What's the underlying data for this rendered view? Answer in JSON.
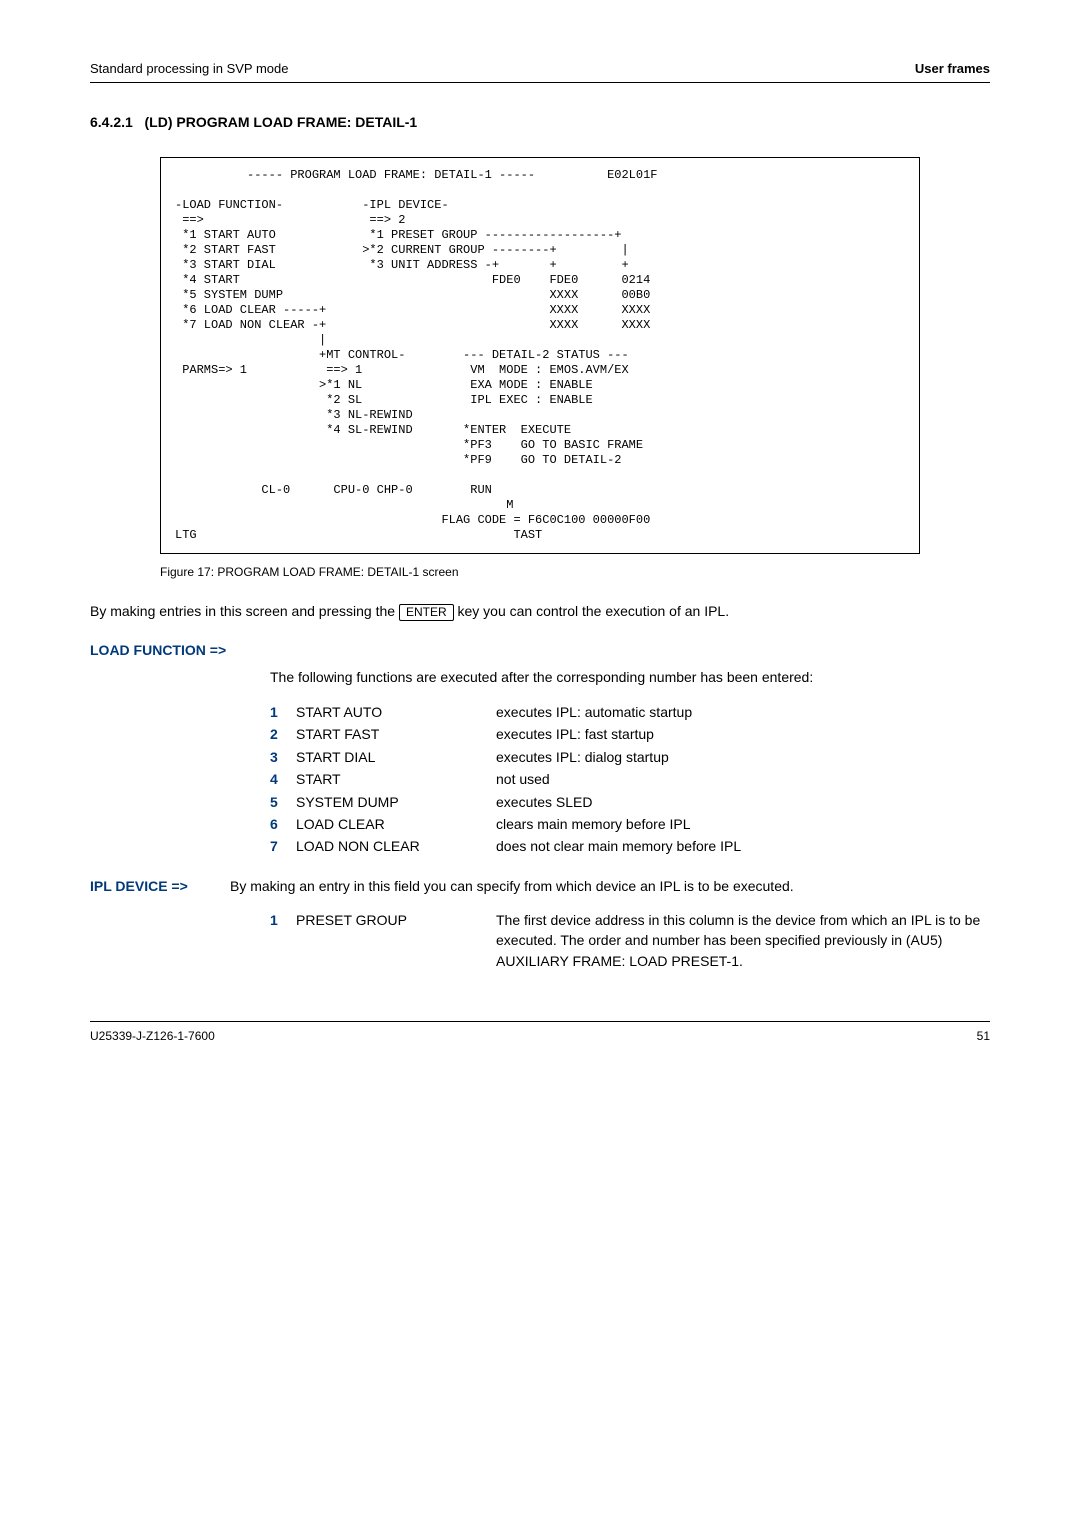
{
  "header": {
    "left": "Standard processing in SVP mode",
    "right": "User frames"
  },
  "section": {
    "number": "6.4.2.1",
    "title": "(LD) PROGRAM LOAD FRAME: DETAIL-1"
  },
  "terminal": "          ----- PROGRAM LOAD FRAME: DETAIL-1 -----          E02L01F\n\n-LOAD FUNCTION-           -IPL DEVICE-\n ==>                       ==> 2\n *1 START AUTO             *1 PRESET GROUP ------------------+\n *2 START FAST            >*2 CURRENT GROUP --------+         |\n *3 START DIAL             *3 UNIT ADDRESS -+       +         +\n *4 START                                   FDE0    FDE0      0214\n *5 SYSTEM DUMP                                     XXXX      00B0\n *6 LOAD CLEAR -----+                               XXXX      XXXX\n *7 LOAD NON CLEAR -+                               XXXX      XXXX\n                    |\n                    +MT CONTROL-        --- DETAIL-2 STATUS ---\n PARMS=> 1           ==> 1               VM  MODE : EMOS.AVM/EX\n                    >*1 NL               EXA MODE : ENABLE\n                     *2 SL               IPL EXEC : ENABLE\n                     *3 NL-REWIND\n                     *4 SL-REWIND       *ENTER  EXECUTE\n                                        *PF3    GO TO BASIC FRAME\n                                        *PF9    GO TO DETAIL-2\n\n            CL-0      CPU-0 CHP-0        RUN\n                                              M\n                                     FLAG CODE = F6C0C100 00000F00\nLTG                                            TAST",
  "fig_caption": "Figure 17: PROGRAM LOAD FRAME: DETAIL-1 screen",
  "body1_a": "By making entries in this screen and pressing the ",
  "body1_key": "ENTER",
  "body1_b": " key you can control the execution of an IPL.",
  "load_function": {
    "heading": "LOAD FUNCTION =>",
    "intro": "The following functions are executed after the corresponding number has been entered:",
    "items": [
      {
        "n": "1",
        "label": "START AUTO",
        "desc": "executes IPL: automatic startup"
      },
      {
        "n": "2",
        "label": "START FAST",
        "desc": "executes IPL: fast startup"
      },
      {
        "n": "3",
        "label": "START DIAL",
        "desc": "executes IPL: dialog startup"
      },
      {
        "n": "4",
        "label": "START",
        "desc": "not used"
      },
      {
        "n": "5",
        "label": "SYSTEM DUMP",
        "desc": "executes SLED"
      },
      {
        "n": "6",
        "label": "LOAD CLEAR",
        "desc": "clears main memory before IPL"
      },
      {
        "n": "7",
        "label": "LOAD NON CLEAR",
        "desc": "does not clear main memory before IPL"
      }
    ]
  },
  "ipl_device": {
    "heading": "IPL DEVICE =>",
    "intro": "By making an entry in this field you can specify from which device an IPL is to be executed.",
    "item": {
      "n": "1",
      "label": "PRESET GROUP",
      "desc": "The first device address in this column is the device from which an IPL is to be executed. The order and number has been specified previously in (AU5) AUXILIARY FRAME: LOAD PRESET-1."
    }
  },
  "footer": {
    "left": "U25339-J-Z126-1-7600",
    "right": "51"
  }
}
